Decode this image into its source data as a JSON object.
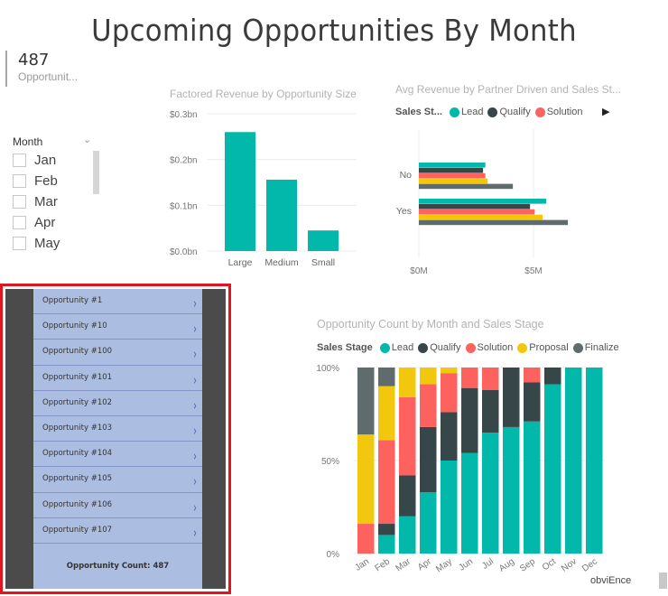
{
  "report": {
    "title": "Upcoming Opportunities By Month"
  },
  "card": {
    "value": "487",
    "label": "Opportunit..."
  },
  "slicer": {
    "title": "Month",
    "items": [
      "Jan",
      "Feb",
      "Mar",
      "Apr",
      "May"
    ]
  },
  "colors": {
    "teal": "#01b8aa",
    "dark": "#374649",
    "red": "#fd625e",
    "yellow": "#f2c80f",
    "gray": "#5f6b6d",
    "powerapp_border": "#e0151f",
    "powerapp_panel": "#abbde0",
    "powerapp_side": "#4b4b4b"
  },
  "powerapp": {
    "items": [
      "Opportunity #1",
      "Opportunity #10",
      "Opportunity #100",
      "Opportunity #101",
      "Opportunity #102",
      "Opportunity #103",
      "Opportunity #104",
      "Opportunity #105",
      "Opportunity #106",
      "Opportunity #107"
    ],
    "chevron": "›",
    "count_label": "Opportunity Count: 487"
  },
  "watermark": "obviEnce",
  "chart_data": [
    {
      "type": "bar",
      "title": "Factored Revenue by Opportunity Size",
      "categories": [
        "Large",
        "Medium",
        "Small"
      ],
      "values": [
        0.26,
        0.156,
        0.045
      ],
      "yticks": [
        "$0.0bn",
        "$0.1bn",
        "$0.2bn",
        "$0.3bn"
      ],
      "ylim": [
        0,
        0.3
      ],
      "xlabel": "",
      "ylabel": "",
      "grid": true,
      "color": "#01b8aa"
    },
    {
      "type": "bar",
      "orientation": "horizontal",
      "title": "Avg Revenue by Partner Driven and Sales St...",
      "legend_title": "Sales St...",
      "legend_visible": [
        "Lead",
        "Qualify",
        "Solution"
      ],
      "legend_more": "▶",
      "categories": [
        "No",
        "Yes"
      ],
      "series": [
        {
          "name": "Lead",
          "color": "#01b8aa",
          "values": [
            2.9,
            5.55
          ]
        },
        {
          "name": "Qualify",
          "color": "#374649",
          "values": [
            2.8,
            4.85
          ]
        },
        {
          "name": "Solution",
          "color": "#fd625e",
          "values": [
            2.9,
            5.05
          ]
        },
        {
          "name": "Proposal",
          "color": "#f2c80f",
          "values": [
            3.0,
            5.4
          ]
        },
        {
          "name": "Finalize",
          "color": "#5f6b6d",
          "values": [
            4.1,
            6.5
          ]
        }
      ],
      "xticks": [
        "$0M",
        "$5M"
      ],
      "xlim": [
        0,
        8
      ],
      "grid": true,
      "legend_position": "top-left"
    },
    {
      "type": "bar",
      "stacked": "percent",
      "title": "Opportunity Count by Month and Sales Stage",
      "legend_title": "Sales Stage",
      "categories": [
        "Jan",
        "Feb",
        "Mar",
        "Apr",
        "May",
        "Jun",
        "Jul",
        "Aug",
        "Sep",
        "Oct",
        "Nov",
        "Dec"
      ],
      "series": [
        {
          "name": "Lead",
          "color": "#01b8aa",
          "values": [
            0,
            10,
            20,
            33,
            50,
            54,
            65,
            68,
            71,
            91,
            100,
            100
          ]
        },
        {
          "name": "Qualify",
          "color": "#374649",
          "values": [
            0,
            6,
            22,
            35,
            26,
            35,
            23,
            32,
            21,
            9,
            0,
            0
          ]
        },
        {
          "name": "Solution",
          "color": "#fd625e",
          "values": [
            16,
            45,
            42,
            23,
            21,
            11,
            12,
            0,
            8,
            0,
            0,
            0
          ]
        },
        {
          "name": "Proposal",
          "color": "#f2c80f",
          "values": [
            48,
            29,
            16,
            9,
            3,
            0,
            0,
            0,
            0,
            0,
            0,
            0
          ]
        },
        {
          "name": "Finalize",
          "color": "#5f6b6d",
          "values": [
            36,
            10,
            0,
            0,
            0,
            0,
            0,
            0,
            0,
            0,
            0,
            0
          ]
        }
      ],
      "yticks": [
        "0%",
        "50%",
        "100%"
      ],
      "ylim": [
        0,
        100
      ],
      "grid": true,
      "legend_position": "top-left"
    }
  ]
}
